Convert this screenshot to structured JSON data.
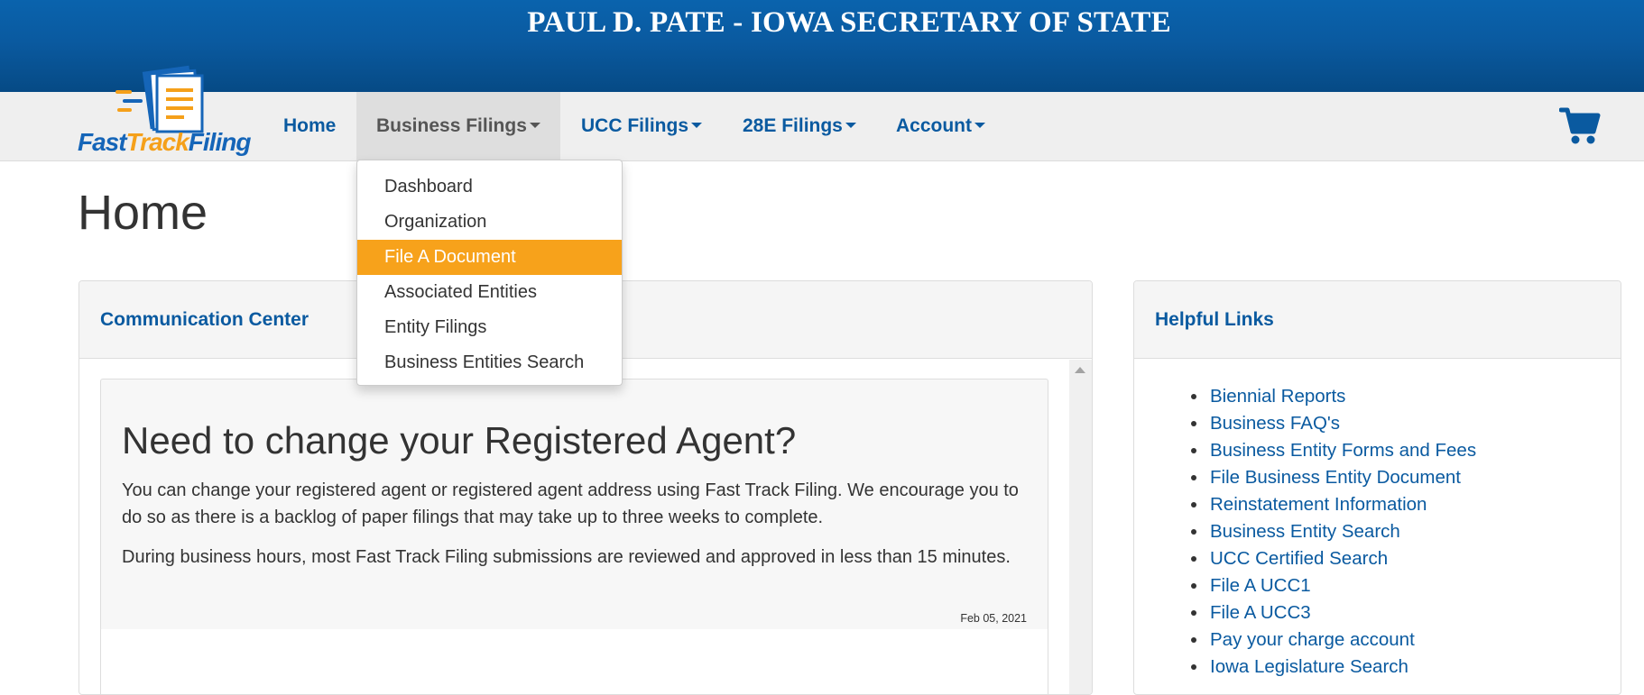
{
  "header": {
    "title": "PAUL D. PATE - IOWA SECRETARY OF STATE"
  },
  "logo": {
    "part1": "Fast",
    "part2": "Track",
    "part3": "Filing"
  },
  "nav": {
    "home": "Home",
    "business_filings": "Business Filings",
    "ucc_filings": "UCC Filings",
    "filings_28e": "28E Filings",
    "account": "Account",
    "cart_icon": "shopping-cart-icon"
  },
  "dropdown": {
    "items": [
      "Dashboard",
      "Organization",
      "File A Document",
      "Associated Entities",
      "Entity Filings",
      "Business Entities Search"
    ],
    "highlighted": "File A Document",
    "highlight_color": "#f7a21b"
  },
  "page": {
    "title": "Home"
  },
  "communication_center": {
    "heading": "Communication Center",
    "notice": {
      "title": "Need to change your Registered Agent?",
      "paragraph1": "You can change your registered agent or registered agent address using Fast Track Filing. We encourage you to do so as there is a backlog of paper filings that may take up to three weeks to complete.",
      "paragraph2": "During business hours, most Fast Track Filing submissions are reviewed and approved in less than 15 minutes.",
      "date": "Feb 05, 2021"
    }
  },
  "helpful_links": {
    "heading": "Helpful Links",
    "items": [
      "Biennial Reports",
      "Business FAQ's",
      "Business Entity Forms and Fees",
      "File Business Entity Document",
      "Reinstatement Information",
      "Business Entity Search",
      "UCC Certified Search",
      "File A UCC1",
      "File A UCC3",
      "Pay your charge account",
      "Iowa Legislature Search"
    ]
  },
  "colors": {
    "brand_blue": "#0a5aa0",
    "accent_orange": "#f7a21b"
  }
}
